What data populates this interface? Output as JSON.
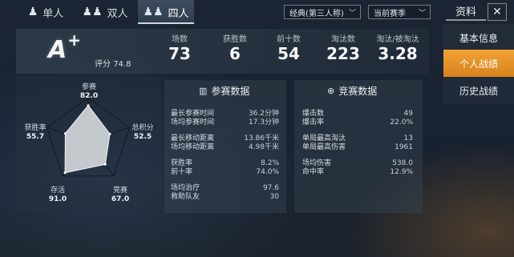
{
  "mode_tabs": [
    {
      "label": "单人",
      "icon": "person-icon",
      "active": false
    },
    {
      "label": "双人",
      "icon": "duo-icon",
      "active": false
    },
    {
      "label": "四人",
      "icon": "squad-icon",
      "active": true
    }
  ],
  "filters": {
    "mode": "经典(第三人称)",
    "season": "当前赛季"
  },
  "resource_tab": "资料",
  "close_label": "✕",
  "side_menu": [
    {
      "label": "基本信息",
      "active": false
    },
    {
      "label": "个人战绩",
      "active": true
    },
    {
      "label": "历史战绩",
      "active": false
    }
  ],
  "summary": {
    "grade": "A",
    "grade_suffix": "+",
    "rating_label": "评分",
    "rating_value": "74.8",
    "stats": [
      {
        "label": "场数",
        "value": "73"
      },
      {
        "label": "获胜数",
        "value": "6"
      },
      {
        "label": "前十数",
        "value": "54"
      },
      {
        "label": "淘汰数",
        "value": "223"
      },
      {
        "label": "淘汰/被淘汰",
        "value": "3.28"
      }
    ]
  },
  "radar": {
    "axes": [
      {
        "label": "参赛",
        "value": 82.0,
        "display": "82.0"
      },
      {
        "label": "总积分",
        "value": 52.5,
        "display": "52.5"
      },
      {
        "label": "竞赛",
        "value": 67.0,
        "display": "67.0"
      },
      {
        "label": "存活",
        "value": 91.0,
        "display": "91.0"
      },
      {
        "label": "获胜率",
        "value": 55.7,
        "display": "55.7"
      }
    ],
    "max": 100
  },
  "participation": {
    "title": "参赛数据",
    "icon": "bar-chart-icon",
    "groups": [
      [
        {
          "k": "最长参赛时间",
          "v": "36.2分钟"
        },
        {
          "k": "场均参赛时间",
          "v": "17.3分钟"
        }
      ],
      [
        {
          "k": "最长移动距离",
          "v": "13.86千米"
        },
        {
          "k": "场均移动距离",
          "v": "4.98千米"
        }
      ],
      [
        {
          "k": "获胜率",
          "v": "8.2%"
        },
        {
          "k": "前十率",
          "v": "74.0%"
        }
      ],
      [
        {
          "k": "场均治疗",
          "v": "97.6"
        },
        {
          "k": "救助队友",
          "v": "30"
        }
      ]
    ]
  },
  "competition": {
    "title": "竞赛数据",
    "icon": "crosshair-icon",
    "groups": [
      [
        {
          "k": "爆击数",
          "v": "49"
        },
        {
          "k": "爆击率",
          "v": "22.0%"
        }
      ],
      [
        {
          "k": "单局最高淘汰",
          "v": "13"
        },
        {
          "k": "单局最高伤害",
          "v": "1961"
        }
      ],
      [
        {
          "k": "场均伤害",
          "v": "538.0"
        },
        {
          "k": "命中率",
          "v": "12.9%"
        }
      ]
    ]
  },
  "colors": {
    "accent": "#e8922a",
    "panel": "#37444f"
  }
}
